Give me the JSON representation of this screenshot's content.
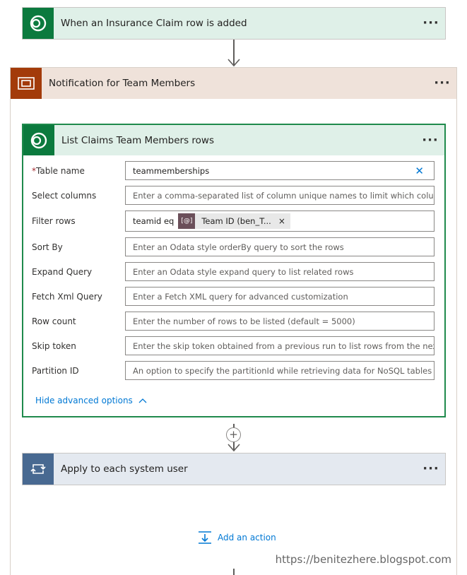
{
  "trigger": {
    "title": "When an Insurance Claim row is added",
    "more": "···"
  },
  "scope": {
    "title": "Notification for Team Members",
    "more": "···"
  },
  "action": {
    "title": "List Claims Team Members rows",
    "more": "···",
    "fields": {
      "table_name": {
        "required_mark": "*",
        "label": "Table name",
        "value": "teammemberships"
      },
      "select_columns": {
        "label": "Select columns",
        "placeholder": "Enter a comma-separated list of column unique names to limit which columns a"
      },
      "filter_rows": {
        "label": "Filter rows",
        "prefix": "teamid eq",
        "token_icon": "[@]",
        "token_text": "Team ID (ben_T...",
        "token_remove": "×"
      },
      "sort_by": {
        "label": "Sort By",
        "placeholder": "Enter an Odata style orderBy query to sort the rows"
      },
      "expand_query": {
        "label": "Expand Query",
        "placeholder": "Enter an Odata style expand query to list related rows"
      },
      "fetch_xml": {
        "label": "Fetch Xml Query",
        "placeholder": "Enter a Fetch XML query for advanced customization"
      },
      "row_count": {
        "label": "Row count",
        "placeholder": "Enter the number of rows to be listed (default = 5000)"
      },
      "skip_token": {
        "label": "Skip token",
        "placeholder": "Enter the skip token obtained from a previous run to list rows from the next pa"
      },
      "partition_id": {
        "label": "Partition ID",
        "placeholder": "An option to specify the partitionId while retrieving data for NoSQL tables"
      }
    },
    "advanced_toggle": "Hide advanced options",
    "advanced_chevron": "^"
  },
  "insert_step": "+",
  "foreach": {
    "title": "Apply to each system user",
    "more": "···"
  },
  "add_action": "Add an action",
  "watermark": "https://benitezhere.blogspot.com",
  "colors": {
    "dataverse": "#0b7a3e",
    "scope": "#a33b0a",
    "control": "#486991",
    "link": "#0078d4"
  }
}
